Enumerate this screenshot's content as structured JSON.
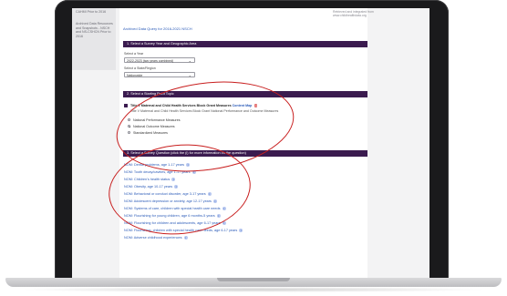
{
  "sidebar": {
    "link1": "CAHMI Prior to 2016",
    "link2": "Archived Data Resources and Snapshots - NSCH and NS-CSHCN Prior to 2016"
  },
  "topright": {
    "line1": "Retrieved and integrated from",
    "line2": "www.childhealthdata.org"
  },
  "archived_link": "Archived Data Query for 2016-2021 NSCH",
  "section1": {
    "header": "1. Select a Survey Year and Geographic Area",
    "year_label": "Select a Year",
    "year_value": "2022-2023 (two years combined)",
    "state_label": "Select a State/Region",
    "state_value": "Nationwide"
  },
  "section2": {
    "header": "2. Select a Starting Point Topic",
    "topic_title": "Title V Maternal and Child Health Services Block Grant Measures",
    "content_map_label": "Content Map",
    "topic_subtitle": "Title V Maternal and Child Health Services Block Grant National Performance and Outcome Measures",
    "options": [
      "National Performance Measures",
      "National Outcome Measures",
      "Standardized Measures"
    ]
  },
  "section3": {
    "header": "3. Select a Survey Question (click the (i) for more information on the question)",
    "questions": [
      "NOM: Dental problems, age 1-17 years",
      "NOM: Tooth decay/cavities, age 1-17 years",
      "NOM: Children's health status",
      "NOM: Obesity, age 10-17 years",
      "NOM: Behavioral or conduct disorder, age 3-17 years",
      "NOM: Adolescent depression or anxiety, age 12-17 years",
      "NOM: Systems of care, children with special health care needs",
      "NOM: Flourishing for young children, age 6 months-5 years",
      "NOM: Flourishing for children and adolescents, age 6-17 years",
      "NOM: Flourishing, children with special health care needs, age 6-17 years",
      "NOM: Adverse childhood experiences"
    ]
  }
}
